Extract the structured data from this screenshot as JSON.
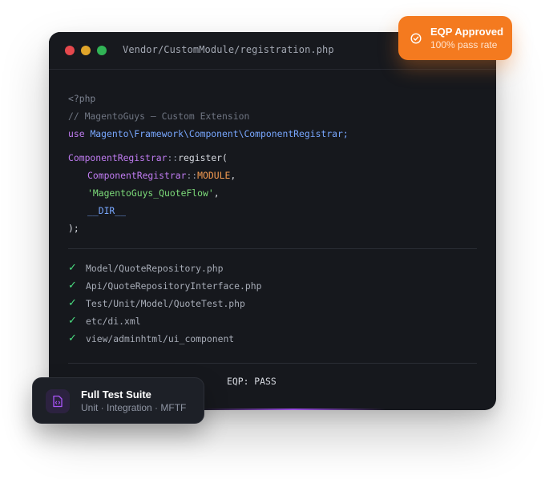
{
  "editor": {
    "file_path": "Vendor/CustomModule/registration.php",
    "code": {
      "php_open": "<?php",
      "comment": "// MagentoGuys — Custom Extension",
      "use_keyword": "use",
      "use_namespace": "Magento\\Framework\\Component\\ComponentRegistrar;",
      "class_name": "ComponentRegistrar",
      "scope_op": "::",
      "method_call": "register(",
      "arg1_class": "ComponentRegistrar",
      "arg1_scope": "::",
      "arg1_const": "MODULE",
      "comma": ",",
      "arg2_string": "'MagentoGuys_QuoteFlow'",
      "arg3_const": "__DIR__",
      "close": ");"
    },
    "checklist": [
      {
        "icon": "checkmark-icon",
        "glyph": "✓",
        "label": "Model/QuoteRepository.php"
      },
      {
        "icon": "checkmark-icon",
        "glyph": "✓",
        "label": "Api/QuoteRepositoryInterface.php"
      },
      {
        "icon": "checkmark-icon",
        "glyph": "✓",
        "label": "Test/Unit/Model/QuoteTest.php"
      },
      {
        "icon": "checkmark-icon",
        "glyph": "✓",
        "label": "etc/di.xml"
      },
      {
        "icon": "checkmark-icon",
        "glyph": "✓",
        "label": "view/adminhtml/ui_component"
      }
    ],
    "status_text": "EQP: PASS"
  },
  "badge": {
    "title": "EQP Approved",
    "subtitle": "100% pass rate",
    "icon": "check-circle-icon",
    "color": "#f47a1f"
  },
  "suite_card": {
    "title": "Full Test Suite",
    "subtitle": "Unit · Integration · MFTF",
    "icon": "code-file-icon",
    "icon_color": "#a855f7"
  },
  "colors": {
    "window_dots": [
      "#e5484d",
      "#e0a52a",
      "#31b456"
    ],
    "editor_bg": "#16181d",
    "check_green": "#4ade80"
  }
}
